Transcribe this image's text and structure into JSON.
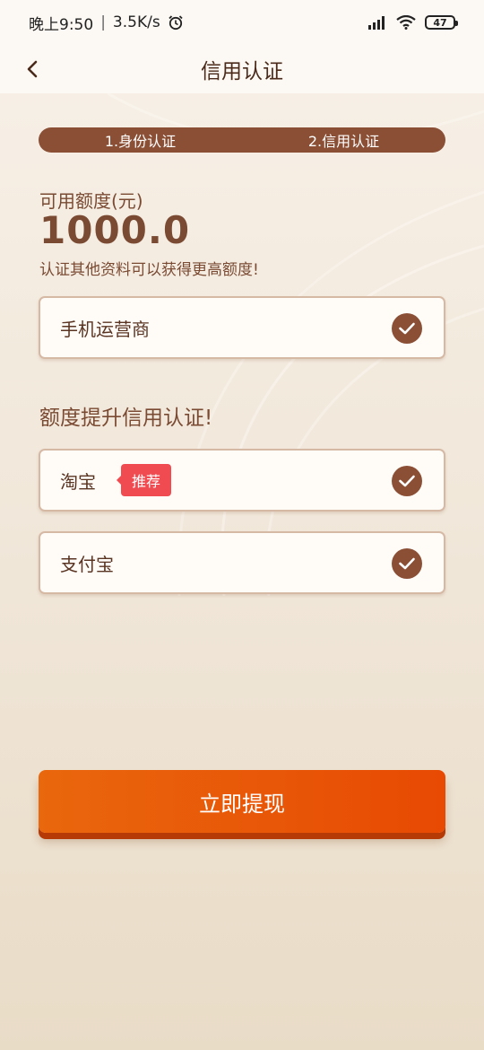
{
  "status_bar": {
    "time": "晚上9:50",
    "network_speed": "3.5K/s",
    "battery_level": "47",
    "icons": [
      "alarm-icon",
      "signal-icon",
      "wifi-icon",
      "battery-icon"
    ]
  },
  "header": {
    "title": "信用认证",
    "back_icon": "chevron-left-icon"
  },
  "steps": [
    "1.身份认证",
    "2.信用认证"
  ],
  "credit": {
    "label": "可用额度(元)",
    "amount": "1000.0",
    "tip": "认证其他资料可以获得更高额度!"
  },
  "basic_items": [
    {
      "label": "手机运营商",
      "status": "verified"
    }
  ],
  "boost_section": {
    "title": "额度提升信用认证!",
    "items": [
      {
        "label": "淘宝",
        "tag": "推荐",
        "status": "verified"
      },
      {
        "label": "支付宝",
        "status": "verified"
      }
    ]
  },
  "action_button": {
    "label": "立即提现"
  },
  "colors": {
    "brown": "#8b4f36",
    "text_brown": "#7a4a33",
    "tag_red": "#f04b51",
    "button_orange": "#e9670d",
    "button_orange_end": "#e84a03"
  }
}
